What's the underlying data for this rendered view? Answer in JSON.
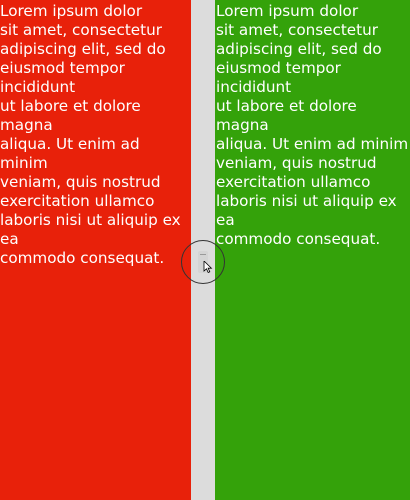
{
  "panes": {
    "left": {
      "text": "Lorem ipsum dolor\nsit amet, consectetur\nadipiscing elit, sed do\neiusmod tempor incididunt\nut labore et dolore magna\naliqua. Ut enim ad minim\nveniam, quis nostrud\nexercitation ullamco\nlaboris nisi ut aliquip ex ea\ncommodo consequat.",
      "background_color": "#e8210a"
    },
    "right": {
      "text": "Lorem ipsum dolor\nsit amet, consectetur\nadipiscing elit, sed do\neiusmod tempor incididunt\nut labore et dolore magna\naliqua. Ut enim ad minim\nveniam, quis nostrud\nexercitation ullamco\nlaboris nisi ut aliquip ex ea\ncommodo consequat.",
      "background_color": "#34a20a"
    }
  },
  "divider": {
    "color": "#dcdcdc",
    "handle_icon": "drag-handle-icon",
    "cursor_icon": "pointer-cursor-icon"
  },
  "colors": {
    "text": "#ffffff"
  }
}
